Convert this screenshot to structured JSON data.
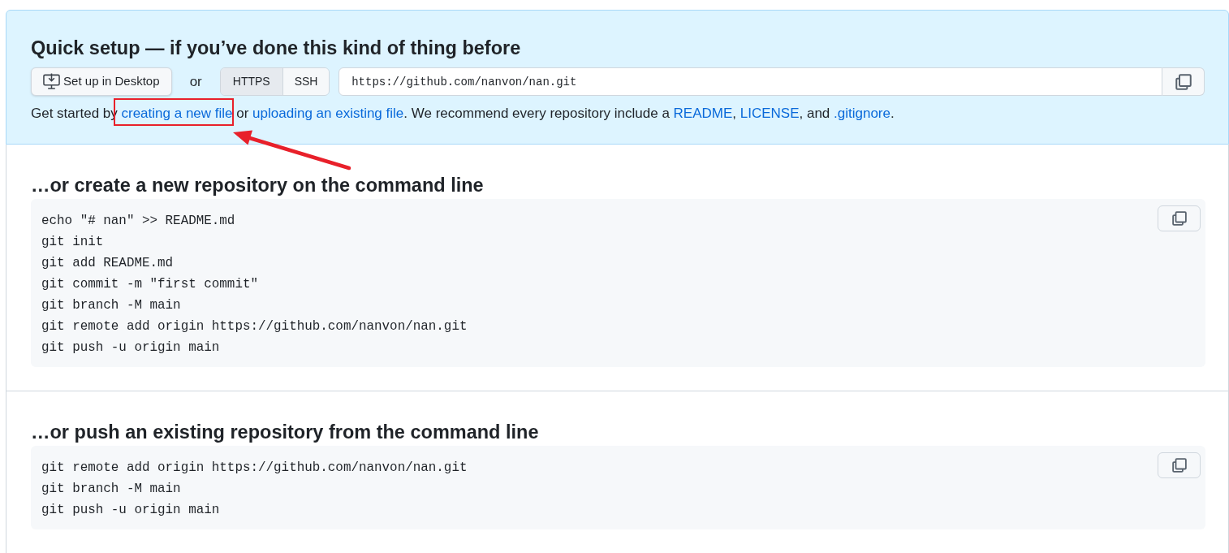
{
  "quick_setup": {
    "title": "Quick setup — if you’ve done this kind of thing before",
    "desktop_button": "Set up in Desktop",
    "or_label": "or",
    "protocols": [
      {
        "label": "HTTPS",
        "selected": true
      },
      {
        "label": "SSH",
        "selected": false
      }
    ],
    "clone_url": "https://github.com/nanvon/nan.git",
    "intro": [
      {
        "kind": "text",
        "text": "Get started by ",
        "highlighted": false
      },
      {
        "kind": "link",
        "text": "creating a new file",
        "highlighted": true
      },
      {
        "kind": "text",
        "text": " or ",
        "highlighted": false
      },
      {
        "kind": "link",
        "text": "uploading an existing file",
        "highlighted": false
      },
      {
        "kind": "text",
        "text": ". We recommend every repository include a ",
        "highlighted": false
      },
      {
        "kind": "link",
        "text": "README",
        "highlighted": false
      },
      {
        "kind": "text",
        "text": ", ",
        "highlighted": false
      },
      {
        "kind": "link",
        "text": "LICENSE",
        "highlighted": false
      },
      {
        "kind": "text",
        "text": ", and ",
        "highlighted": false
      },
      {
        "kind": "link",
        "text": ".gitignore",
        "highlighted": false
      },
      {
        "kind": "text",
        "text": ".",
        "highlighted": false
      }
    ]
  },
  "sections": [
    {
      "title": "…or create a new repository on the command line",
      "commands": [
        "echo \"# nan\" >> README.md",
        "git init",
        "git add README.md",
        "git commit -m \"first commit\"",
        "git branch -M main",
        "git remote add origin https://github.com/nanvon/nan.git",
        "git push -u origin main"
      ]
    },
    {
      "title": "…or push an existing repository from the command line",
      "commands": [
        "git remote add origin https://github.com/nanvon/nan.git",
        "git branch -M main",
        "git push -u origin main"
      ]
    }
  ]
}
